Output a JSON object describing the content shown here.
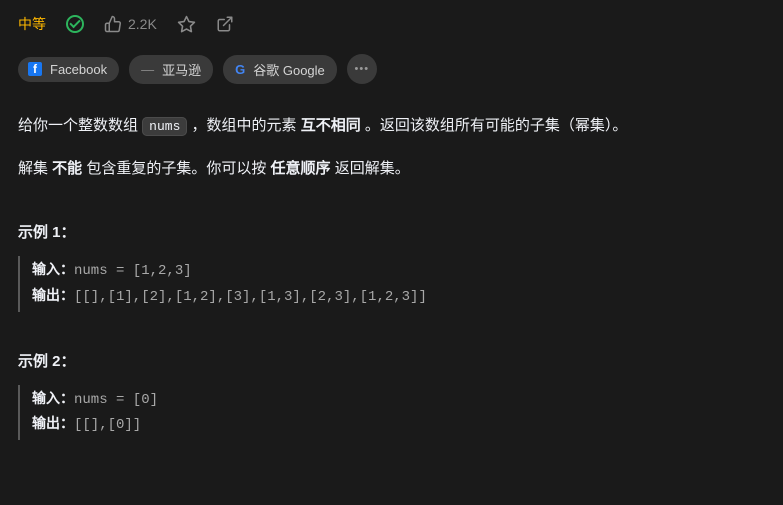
{
  "topbar": {
    "difficulty": "中等",
    "likes": "2.2K"
  },
  "tags": {
    "facebook": "Facebook",
    "amazon_prefix": "—",
    "amazon": "亚马逊",
    "google_prefix": "G",
    "google": "谷歌 Google",
    "more": "•••"
  },
  "description": {
    "p1_a": "给你一个整数数组 ",
    "p1_code": "nums",
    "p1_b": " ，数组中的元素 ",
    "p1_bold": "互不相同",
    "p1_c": " 。返回该数组所有可能的子集（幂集）。",
    "p2_a": "解集 ",
    "p2_bold1": "不能",
    "p2_b": " 包含重复的子集。你可以按 ",
    "p2_bold2": "任意顺序",
    "p2_c": " 返回解集。"
  },
  "examples": [
    {
      "heading": "示例 1：",
      "input_label": "输入：",
      "input_value": "nums = [1,2,3]",
      "output_label": "输出：",
      "output_value": "[[],[1],[2],[1,2],[3],[1,3],[2,3],[1,2,3]]"
    },
    {
      "heading": "示例 2：",
      "input_label": "输入：",
      "input_value": "nums = [0]",
      "output_label": "输出：",
      "output_value": "[[],[0]]"
    }
  ]
}
